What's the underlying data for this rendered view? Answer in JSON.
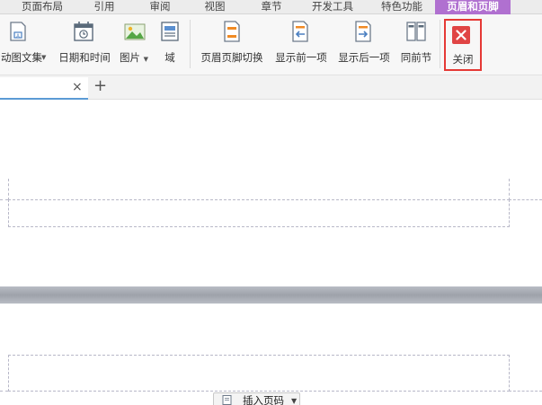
{
  "menu": {
    "tabs": [
      {
        "label": "页面布局"
      },
      {
        "label": "引用"
      },
      {
        "label": "审阅"
      },
      {
        "label": "视图"
      },
      {
        "label": "章节"
      },
      {
        "label": "开发工具"
      },
      {
        "label": "特色功能"
      },
      {
        "label": "页眉和页脚",
        "active": true
      }
    ]
  },
  "ribbon": {
    "text_box_label": "动图文集",
    "date_time_label": "日期和时间",
    "picture_label": "图片",
    "field_label": "域",
    "switch_label": "页眉页脚切换",
    "show_prev_label": "显示前一项",
    "show_next_label": "显示后一项",
    "same_as_prev_label": "同前节",
    "close_label": "关闭"
  },
  "doc_tabs": {
    "close_glyph": "×",
    "new_tab_glyph": "+"
  },
  "footer": {
    "insert_page_number_label": "插入页码"
  },
  "colors": {
    "active_tab": "#b070d0",
    "close_highlight": "#e53935",
    "close_icon": "#e04444"
  }
}
